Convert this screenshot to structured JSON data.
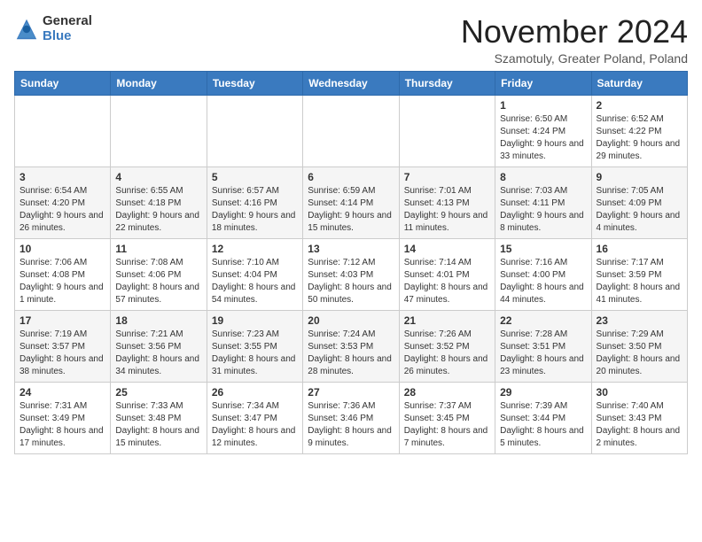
{
  "logo": {
    "general": "General",
    "blue": "Blue"
  },
  "title": "November 2024",
  "subtitle": "Szamotuly, Greater Poland, Poland",
  "days_of_week": [
    "Sunday",
    "Monday",
    "Tuesday",
    "Wednesday",
    "Thursday",
    "Friday",
    "Saturday"
  ],
  "weeks": [
    [
      {
        "day": "",
        "info": ""
      },
      {
        "day": "",
        "info": ""
      },
      {
        "day": "",
        "info": ""
      },
      {
        "day": "",
        "info": ""
      },
      {
        "day": "",
        "info": ""
      },
      {
        "day": "1",
        "info": "Sunrise: 6:50 AM\nSunset: 4:24 PM\nDaylight: 9 hours and 33 minutes."
      },
      {
        "day": "2",
        "info": "Sunrise: 6:52 AM\nSunset: 4:22 PM\nDaylight: 9 hours and 29 minutes."
      }
    ],
    [
      {
        "day": "3",
        "info": "Sunrise: 6:54 AM\nSunset: 4:20 PM\nDaylight: 9 hours and 26 minutes."
      },
      {
        "day": "4",
        "info": "Sunrise: 6:55 AM\nSunset: 4:18 PM\nDaylight: 9 hours and 22 minutes."
      },
      {
        "day": "5",
        "info": "Sunrise: 6:57 AM\nSunset: 4:16 PM\nDaylight: 9 hours and 18 minutes."
      },
      {
        "day": "6",
        "info": "Sunrise: 6:59 AM\nSunset: 4:14 PM\nDaylight: 9 hours and 15 minutes."
      },
      {
        "day": "7",
        "info": "Sunrise: 7:01 AM\nSunset: 4:13 PM\nDaylight: 9 hours and 11 minutes."
      },
      {
        "day": "8",
        "info": "Sunrise: 7:03 AM\nSunset: 4:11 PM\nDaylight: 9 hours and 8 minutes."
      },
      {
        "day": "9",
        "info": "Sunrise: 7:05 AM\nSunset: 4:09 PM\nDaylight: 9 hours and 4 minutes."
      }
    ],
    [
      {
        "day": "10",
        "info": "Sunrise: 7:06 AM\nSunset: 4:08 PM\nDaylight: 9 hours and 1 minute."
      },
      {
        "day": "11",
        "info": "Sunrise: 7:08 AM\nSunset: 4:06 PM\nDaylight: 8 hours and 57 minutes."
      },
      {
        "day": "12",
        "info": "Sunrise: 7:10 AM\nSunset: 4:04 PM\nDaylight: 8 hours and 54 minutes."
      },
      {
        "day": "13",
        "info": "Sunrise: 7:12 AM\nSunset: 4:03 PM\nDaylight: 8 hours and 50 minutes."
      },
      {
        "day": "14",
        "info": "Sunrise: 7:14 AM\nSunset: 4:01 PM\nDaylight: 8 hours and 47 minutes."
      },
      {
        "day": "15",
        "info": "Sunrise: 7:16 AM\nSunset: 4:00 PM\nDaylight: 8 hours and 44 minutes."
      },
      {
        "day": "16",
        "info": "Sunrise: 7:17 AM\nSunset: 3:59 PM\nDaylight: 8 hours and 41 minutes."
      }
    ],
    [
      {
        "day": "17",
        "info": "Sunrise: 7:19 AM\nSunset: 3:57 PM\nDaylight: 8 hours and 38 minutes."
      },
      {
        "day": "18",
        "info": "Sunrise: 7:21 AM\nSunset: 3:56 PM\nDaylight: 8 hours and 34 minutes."
      },
      {
        "day": "19",
        "info": "Sunrise: 7:23 AM\nSunset: 3:55 PM\nDaylight: 8 hours and 31 minutes."
      },
      {
        "day": "20",
        "info": "Sunrise: 7:24 AM\nSunset: 3:53 PM\nDaylight: 8 hours and 28 minutes."
      },
      {
        "day": "21",
        "info": "Sunrise: 7:26 AM\nSunset: 3:52 PM\nDaylight: 8 hours and 26 minutes."
      },
      {
        "day": "22",
        "info": "Sunrise: 7:28 AM\nSunset: 3:51 PM\nDaylight: 8 hours and 23 minutes."
      },
      {
        "day": "23",
        "info": "Sunrise: 7:29 AM\nSunset: 3:50 PM\nDaylight: 8 hours and 20 minutes."
      }
    ],
    [
      {
        "day": "24",
        "info": "Sunrise: 7:31 AM\nSunset: 3:49 PM\nDaylight: 8 hours and 17 minutes."
      },
      {
        "day": "25",
        "info": "Sunrise: 7:33 AM\nSunset: 3:48 PM\nDaylight: 8 hours and 15 minutes."
      },
      {
        "day": "26",
        "info": "Sunrise: 7:34 AM\nSunset: 3:47 PM\nDaylight: 8 hours and 12 minutes."
      },
      {
        "day": "27",
        "info": "Sunrise: 7:36 AM\nSunset: 3:46 PM\nDaylight: 8 hours and 9 minutes."
      },
      {
        "day": "28",
        "info": "Sunrise: 7:37 AM\nSunset: 3:45 PM\nDaylight: 8 hours and 7 minutes."
      },
      {
        "day": "29",
        "info": "Sunrise: 7:39 AM\nSunset: 3:44 PM\nDaylight: 8 hours and 5 minutes."
      },
      {
        "day": "30",
        "info": "Sunrise: 7:40 AM\nSunset: 3:43 PM\nDaylight: 8 hours and 2 minutes."
      }
    ]
  ]
}
